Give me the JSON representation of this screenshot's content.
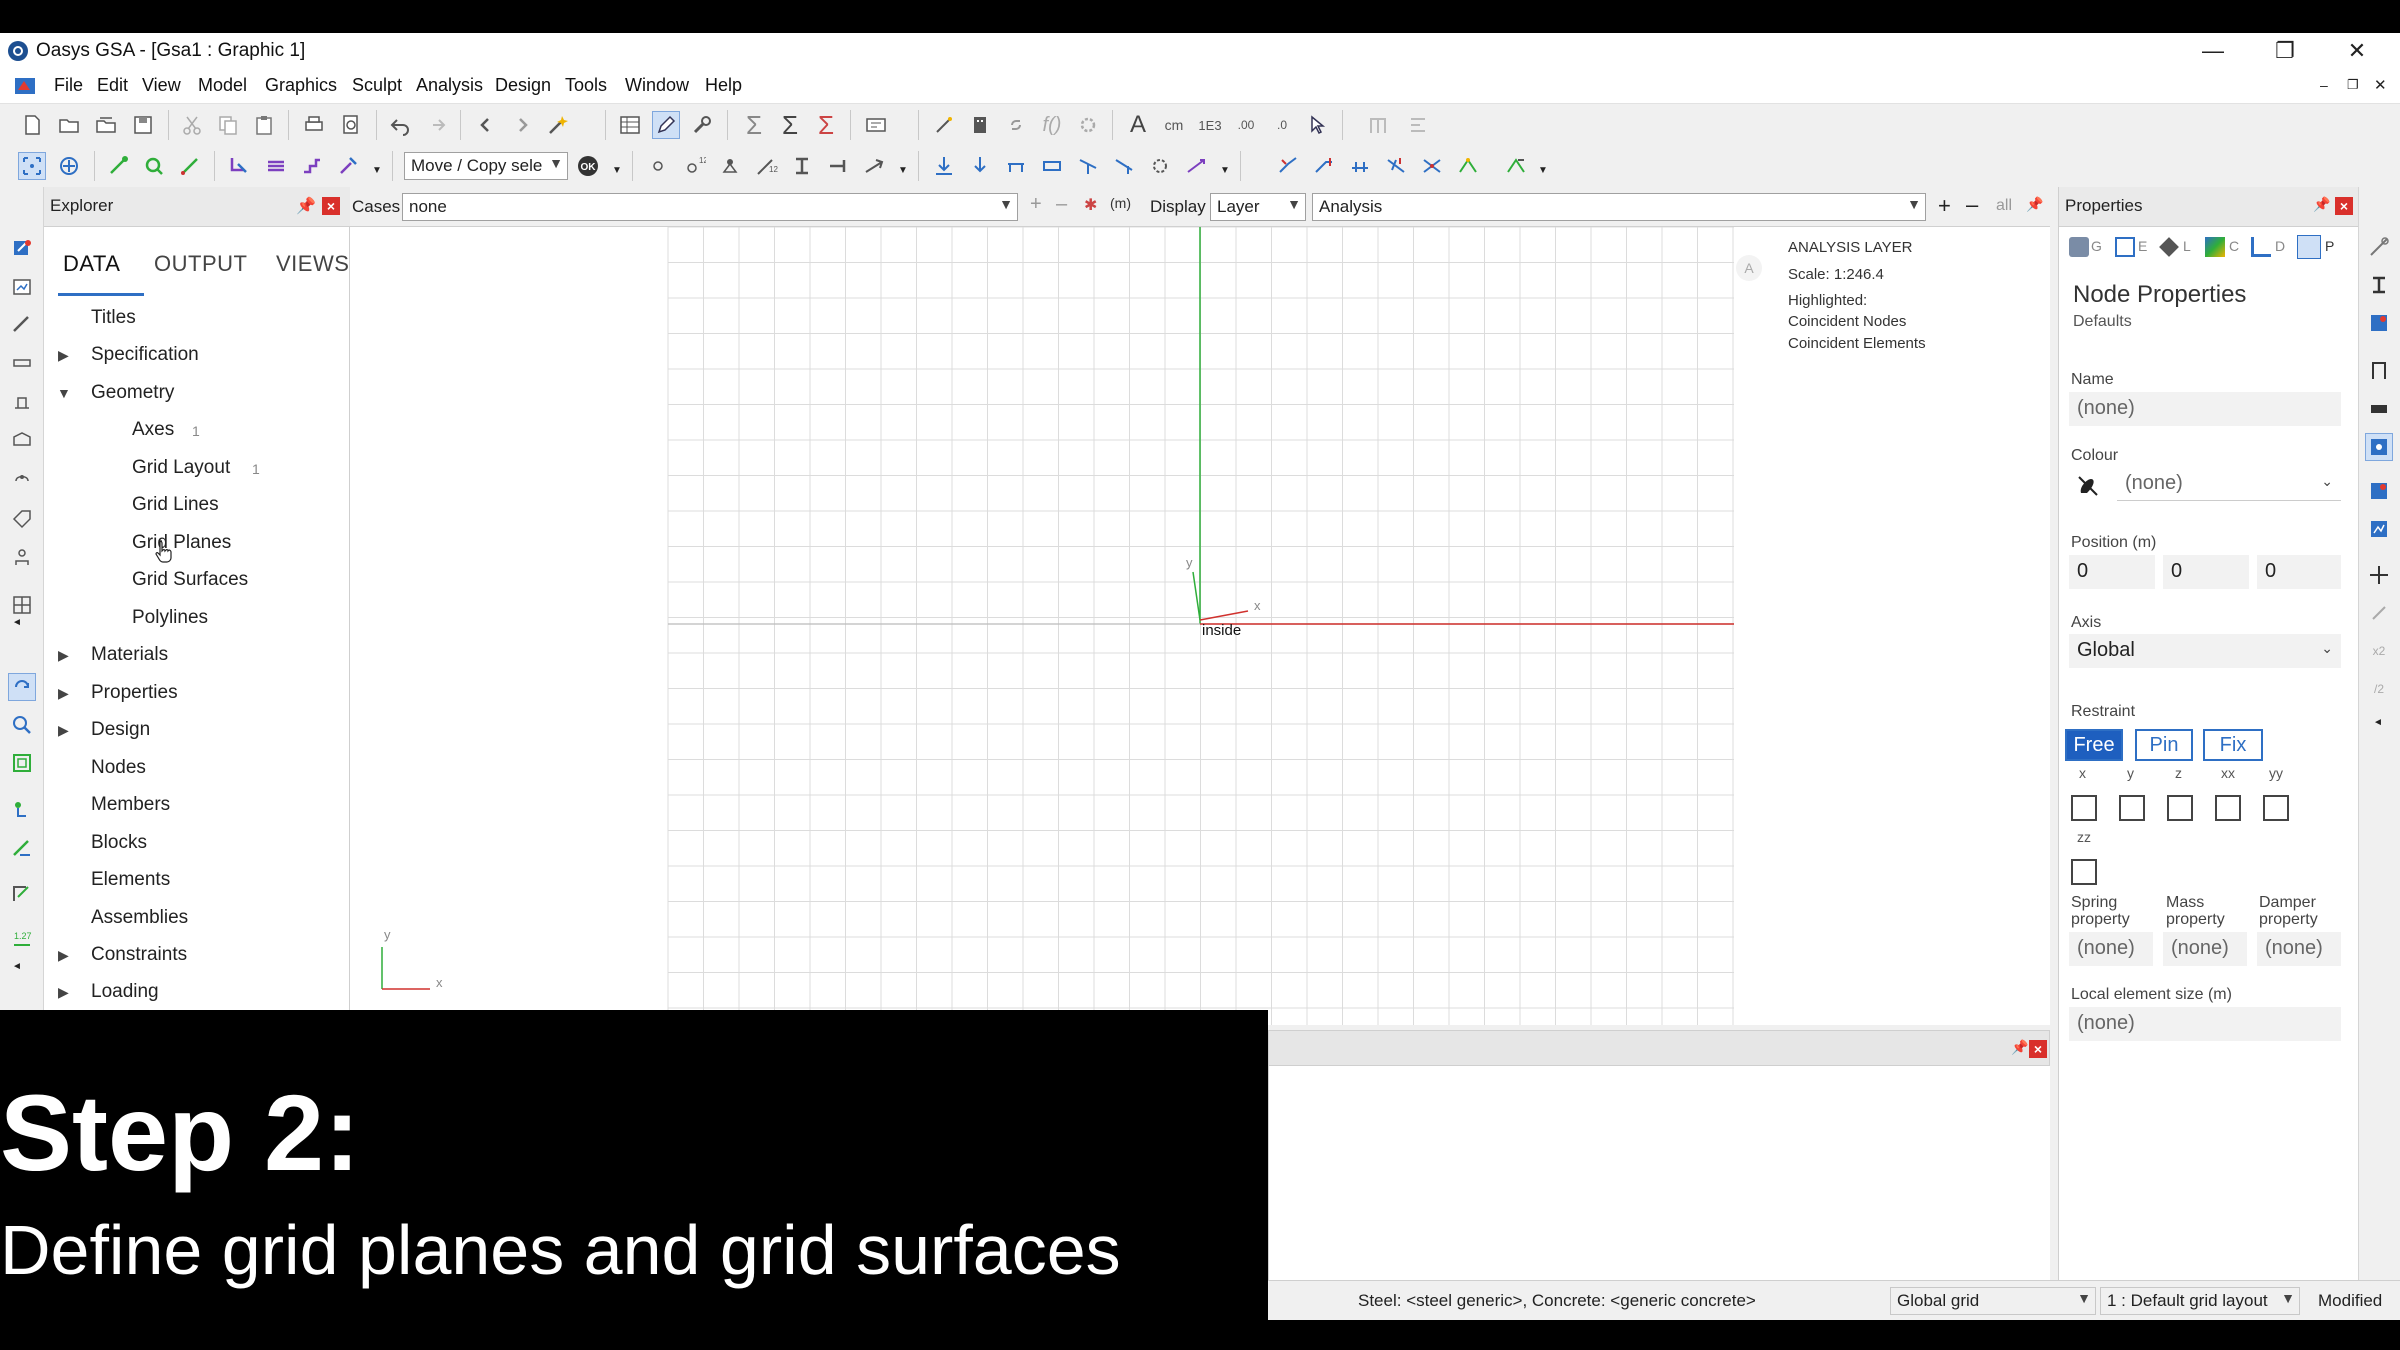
{
  "window": {
    "title": "Oasys GSA - [Gsa1 : Graphic 1]",
    "controls": [
      "minimize",
      "restore",
      "close"
    ]
  },
  "menu": [
    "File",
    "Edit",
    "View",
    "Model",
    "Graphics",
    "Sculpt",
    "Analysis",
    "Design",
    "Tools",
    "Window",
    "Help"
  ],
  "toolbar": {
    "move_copy_label": "Move / Copy sele"
  },
  "explorer": {
    "title": "Explorer",
    "tabs": [
      "DATA",
      "OUTPUT",
      "VIEWS"
    ],
    "active_tab": "DATA",
    "tree": [
      {
        "label": "Titles",
        "level": 0,
        "expand": "none"
      },
      {
        "label": "Specification",
        "level": 0,
        "expand": "collapsed"
      },
      {
        "label": "Geometry",
        "level": 0,
        "expand": "expanded"
      },
      {
        "label": "Axes",
        "level": 1,
        "count": "1"
      },
      {
        "label": "Grid Layout",
        "level": 1,
        "count": "1"
      },
      {
        "label": "Grid Lines",
        "level": 1
      },
      {
        "label": "Grid Planes",
        "level": 1
      },
      {
        "label": "Grid Surfaces",
        "level": 1
      },
      {
        "label": "Polylines",
        "level": 1
      },
      {
        "label": "Materials",
        "level": 0,
        "expand": "collapsed"
      },
      {
        "label": "Properties",
        "level": 0,
        "expand": "collapsed"
      },
      {
        "label": "Design",
        "level": 0,
        "expand": "collapsed"
      },
      {
        "label": "Nodes",
        "level": 0,
        "expand": "none"
      },
      {
        "label": "Members",
        "level": 0,
        "expand": "none"
      },
      {
        "label": "Blocks",
        "level": 0,
        "expand": "none"
      },
      {
        "label": "Elements",
        "level": 0,
        "expand": "none"
      },
      {
        "label": "Assemblies",
        "level": 0,
        "expand": "none"
      },
      {
        "label": "Constraints",
        "level": 0,
        "expand": "collapsed"
      },
      {
        "label": "Loading",
        "level": 0,
        "expand": "collapsed"
      }
    ]
  },
  "graphic": {
    "cases_label": "Cases",
    "cases_value": "none",
    "display_label": "Display",
    "display_value": "Layer",
    "analysis_value": "Analysis",
    "all_label": "all",
    "info": {
      "layer": "ANALYSIS LAYER",
      "scale": "Scale: 1:246.4",
      "highlighted": "Highlighted:",
      "coincident_nodes": "Coincident Nodes",
      "coincident_elements": "Coincident Elements"
    },
    "badge": "A",
    "origin_label": "inside",
    "axis_y": "y",
    "axis_x": "x"
  },
  "properties": {
    "title": "Properties",
    "heading": "Node Properties",
    "subheading": "Defaults",
    "tab_letters": [
      "G",
      "E",
      "L",
      "C",
      "D",
      "P"
    ],
    "name_label": "Name",
    "name_value": "(none)",
    "colour_label": "Colour",
    "colour_value": "(none)",
    "position_label": "Position (m)",
    "position": [
      "0",
      "0",
      "0"
    ],
    "axis_label": "Axis",
    "axis_value": "Global",
    "restraint_label": "Restraint",
    "restraint_buttons": [
      "Free",
      "Pin",
      "Fix"
    ],
    "restraint_active": "Free",
    "dof_labels": [
      "x",
      "y",
      "z",
      "xx",
      "yy",
      "zz"
    ],
    "spring_label_1": "Spring",
    "spring_label_2": "property",
    "mass_label_1": "Mass",
    "mass_label_2": "property",
    "damper_label_1": "Damper",
    "damper_label_2": "property",
    "spring_value": "(none)",
    "mass_value": "(none)",
    "damper_value": "(none)",
    "element_size_label": "Local element size (m)",
    "element_size_value": "(none)"
  },
  "statusbar": {
    "materials": "Steel: <steel generic>, Concrete: <generic concrete>",
    "grid": "Global grid",
    "layout": "1 : Default grid layout",
    "state": "Modified"
  },
  "caption": {
    "title": "Step 2:",
    "subtitle": "Define grid planes and grid surfaces"
  },
  "colors": {
    "accent": "#1e5fbf",
    "close_red": "#d9302b",
    "axis_green": "#2fae3a",
    "axis_red": "#d0312d",
    "grid": "#dcdcdc"
  }
}
